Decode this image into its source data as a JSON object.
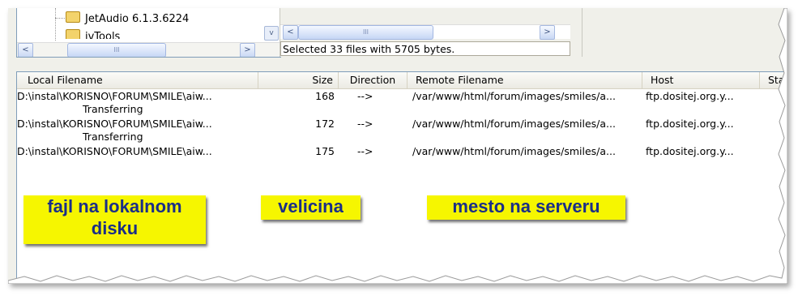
{
  "tree": {
    "items": [
      {
        "label": "JetAudio 6.1.3.6224",
        "icon": "folder-icon"
      },
      {
        "label": "jvTools",
        "icon": "folder-icon"
      }
    ],
    "scroll_thumb_glyph": "III",
    "scroll_left_glyph": "<",
    "scroll_right_glyph": ">",
    "scroll_down_glyph": "v"
  },
  "remote_pane": {
    "scroll_thumb_glyph": "III",
    "scroll_left_glyph": "<",
    "scroll_right_glyph": ">",
    "status": "Selected 33 files with 5705 bytes."
  },
  "queue": {
    "columns": [
      "Local Filename",
      "Size",
      "Direction",
      "Remote Filename",
      "Host",
      "Stat"
    ],
    "rows": [
      {
        "local": "D:\\instal\\KORISNO\\FORUM\\SMILE\\aiw...",
        "size": "168",
        "direction": "-->",
        "remote": "/var/www/html/forum/images/smiles/a...",
        "host": "ftp.dositej.org.y...",
        "status": "Transferring"
      },
      {
        "local": "D:\\instal\\KORISNO\\FORUM\\SMILE\\aiw...",
        "size": "172",
        "direction": "-->",
        "remote": "/var/www/html/forum/images/smiles/a...",
        "host": "ftp.dositej.org.y...",
        "status": "Transferring"
      },
      {
        "local": "D:\\instal\\KORISNO\\FORUM\\SMILE\\aiw...",
        "size": "175",
        "direction": "-->",
        "remote": "/var/www/html/forum/images/smiles/a...",
        "host": "ftp.dositej.org.y...",
        "status": ""
      }
    ]
  },
  "annotations": {
    "local": [
      "fajl na lokalnom",
      "disku"
    ],
    "size": "velicina",
    "remote": "mesto na serveru"
  },
  "colors": {
    "callout_bg": "#f6f600",
    "callout_text": "#1a2e88",
    "list_border": "#7f9db9"
  }
}
